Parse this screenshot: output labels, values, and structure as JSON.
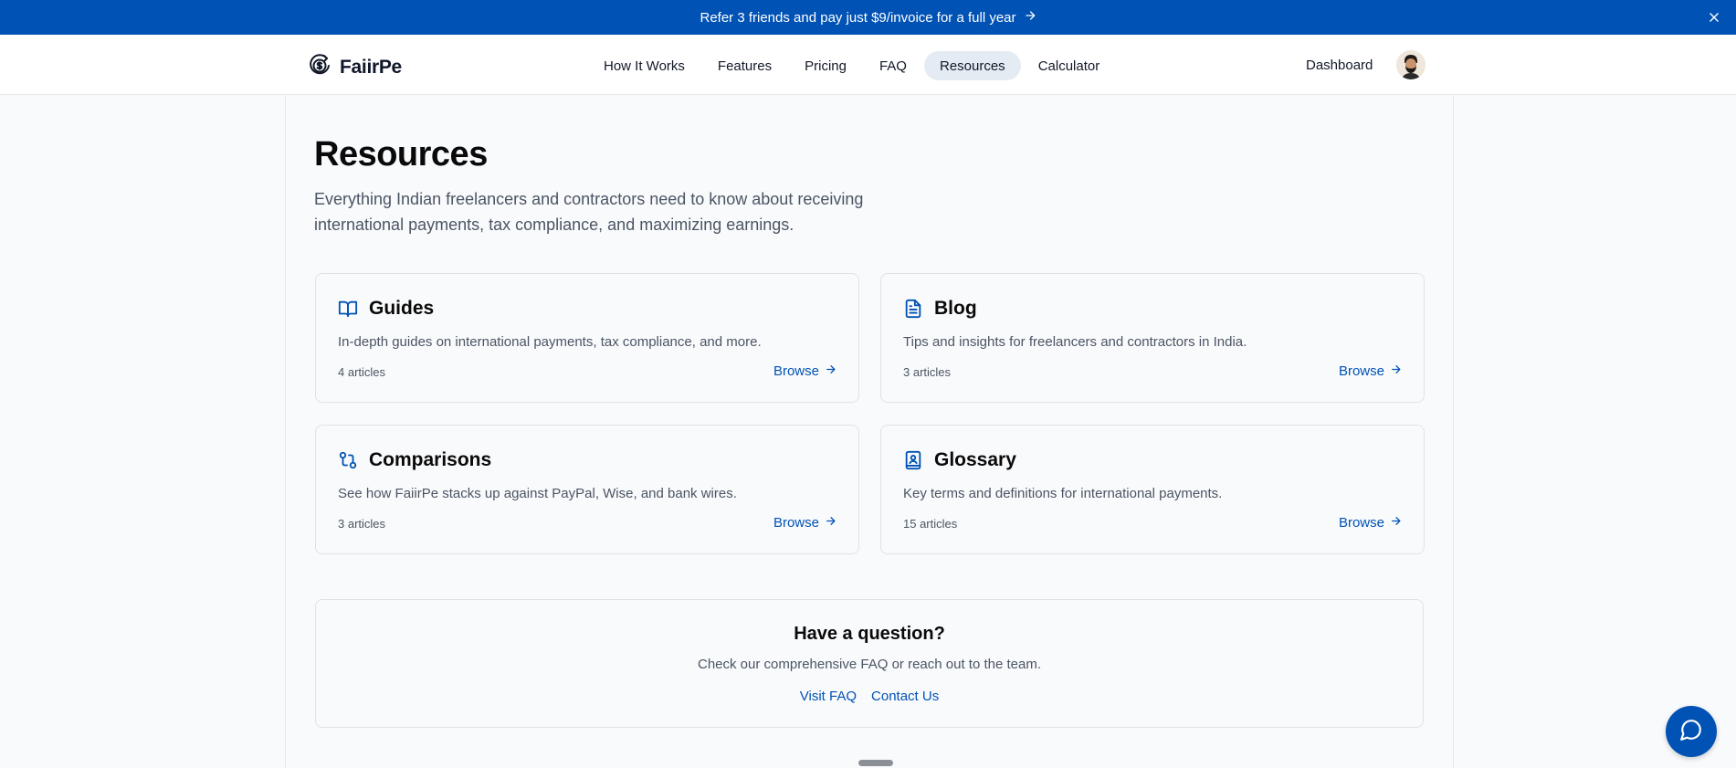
{
  "banner": {
    "text": "Refer 3 friends and pay just $9/invoice for a full year",
    "arrow": "→",
    "close_icon": "close-icon"
  },
  "brand": {
    "name": "FaiirPe",
    "logo_icon": "circular-rupee-coin-icon"
  },
  "nav": {
    "items": [
      {
        "label": "How It Works",
        "active": false
      },
      {
        "label": "Features",
        "active": false
      },
      {
        "label": "Pricing",
        "active": false
      },
      {
        "label": "FAQ",
        "active": false
      },
      {
        "label": "Resources",
        "active": true
      },
      {
        "label": "Calculator",
        "active": false
      }
    ],
    "dashboard": "Dashboard",
    "avatar_icon": "user-avatar"
  },
  "page": {
    "title": "Resources",
    "subtitle": "Everything Indian freelancers and contractors need to know about receiving international payments, tax compliance, and maximizing earnings."
  },
  "cards": [
    {
      "icon": "book-open-icon",
      "title": "Guides",
      "description": "In-depth guides on international payments, tax compliance, and more.",
      "count": "4 articles",
      "browse": "Browse"
    },
    {
      "icon": "file-text-icon",
      "title": "Blog",
      "description": "Tips and insights for freelancers and contractors in India.",
      "count": "3 articles",
      "browse": "Browse"
    },
    {
      "icon": "git-compare-icon",
      "title": "Comparisons",
      "description": "See how FaiirPe stacks up against PayPal, Wise, and bank wires.",
      "count": "3 articles",
      "browse": "Browse"
    },
    {
      "icon": "book-user-icon",
      "title": "Glossary",
      "description": "Key terms and definitions for international payments.",
      "count": "15 articles",
      "browse": "Browse"
    }
  ],
  "question": {
    "title": "Have a question?",
    "description": "Check our comprehensive FAQ or reach out to the team.",
    "faq_link": "Visit FAQ",
    "contact_link": "Contact Us"
  },
  "chat": {
    "icon": "chat-bubble-icon"
  },
  "colors": {
    "brand_blue": "#0052b4",
    "active_nav_bg": "#e5ebf3",
    "page_bg": "#f9fafc"
  }
}
